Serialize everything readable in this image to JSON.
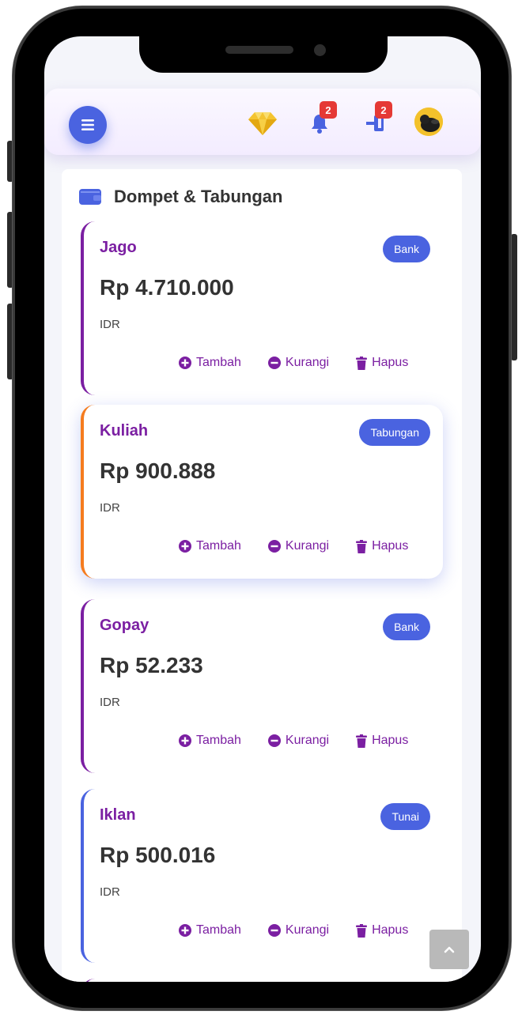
{
  "header": {
    "notifications_badge": "2",
    "login_badge": "2"
  },
  "section": {
    "title": "Dompet & Tabungan"
  },
  "wallets": [
    {
      "name": "Jago",
      "tag": "Bank",
      "amount": "Rp 4.710.000",
      "currency": "IDR",
      "accent": "#7b1fa2"
    },
    {
      "name": "Kuliah",
      "tag": "Tabungan",
      "amount": "Rp 900.888",
      "currency": "IDR",
      "accent": "#f57c1f"
    },
    {
      "name": "Gopay",
      "tag": "Bank",
      "amount": "Rp 52.233",
      "currency": "IDR",
      "accent": "#7b1fa2"
    },
    {
      "name": "Iklan",
      "tag": "Tunai",
      "amount": "Rp 500.016",
      "currency": "IDR",
      "accent": "#4a63e0"
    }
  ],
  "actions": {
    "add": "Tambah",
    "subtract": "Kurangi",
    "delete": "Hapus"
  },
  "colors": {
    "primary": "#4a63e0",
    "purple": "#7b1fa2",
    "badge": "#e53935"
  },
  "icons": {
    "menu": "hamburger-icon",
    "premium": "diamond-icon",
    "notifications": "bell-icon",
    "login": "sign-in-icon",
    "wallet": "wallet-icon",
    "add": "plus-circle-icon",
    "subtract": "minus-circle-icon",
    "delete": "trash-icon",
    "scroll": "chevron-up-icon"
  }
}
